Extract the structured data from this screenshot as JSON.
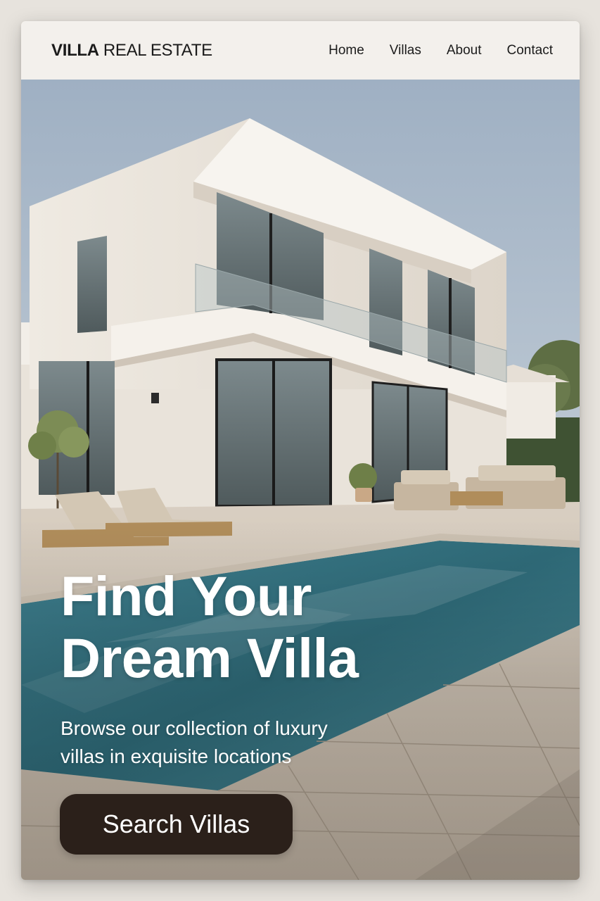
{
  "header": {
    "logo_bold": "VILLA",
    "logo_light": "REAL ESTATE",
    "nav": [
      {
        "label": "Home"
      },
      {
        "label": "Villas"
      },
      {
        "label": "About"
      },
      {
        "label": "Contact"
      }
    ]
  },
  "hero": {
    "title": "Find Your Dream Villa",
    "subtitle": "Browse our collection of luxury villas in exquisite locations",
    "cta_label": "Search Villas",
    "image_subject": "modern white villa with pool"
  },
  "colors": {
    "nav_background": "#f3f0ec",
    "button_background": "#2b201a",
    "text_dark": "#1b1b1b",
    "hero_text": "#ffffff"
  }
}
